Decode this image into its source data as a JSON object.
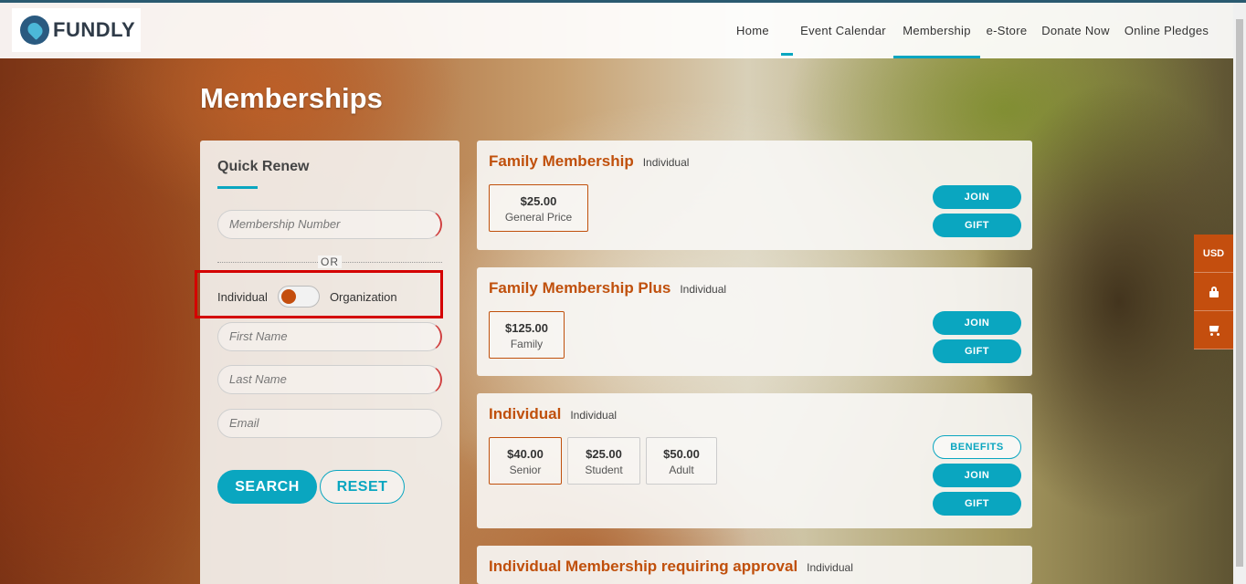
{
  "brand": {
    "name": "FUNDLY"
  },
  "nav": [
    "Home",
    "Event Calendar",
    "Membership",
    "e-Store",
    "Donate Now",
    "Online Pledges"
  ],
  "page_title": "Memberships",
  "quick_renew": {
    "title": "Quick Renew",
    "membership_number_placeholder": "Membership Number",
    "or_text": "OR",
    "toggle_left": "Individual",
    "toggle_right": "Organization",
    "first_name_placeholder": "First Name",
    "last_name_placeholder": "Last Name",
    "email_placeholder": "Email",
    "search_label": "SEARCH",
    "reset_label": "RESET"
  },
  "memberships": [
    {
      "name": "Family Membership",
      "type": "Individual",
      "prices": [
        {
          "amount": "$25.00",
          "label": "General Price"
        }
      ],
      "buttons": [
        "JOIN",
        "GIFT"
      ]
    },
    {
      "name": "Family Membership Plus",
      "type": "Individual",
      "prices": [
        {
          "amount": "$125.00",
          "label": "Family"
        }
      ],
      "buttons": [
        "JOIN",
        "GIFT"
      ]
    },
    {
      "name": "Individual",
      "type": "Individual",
      "prices": [
        {
          "amount": "$40.00",
          "label": "Senior"
        },
        {
          "amount": "$25.00",
          "label": "Student"
        },
        {
          "amount": "$50.00",
          "label": "Adult"
        }
      ],
      "buttons": [
        "BENEFITS",
        "JOIN",
        "GIFT"
      ]
    },
    {
      "name": "Individual Membership requiring approval",
      "type": "Individual"
    }
  ],
  "side_widget": {
    "currency": "USD",
    "lock_icon": "lock-icon",
    "cart_icon": "cart-icon"
  },
  "colors": {
    "accent": "#0aa6c0",
    "brand_orange": "#c0500c",
    "highlight_red": "#d40000"
  }
}
